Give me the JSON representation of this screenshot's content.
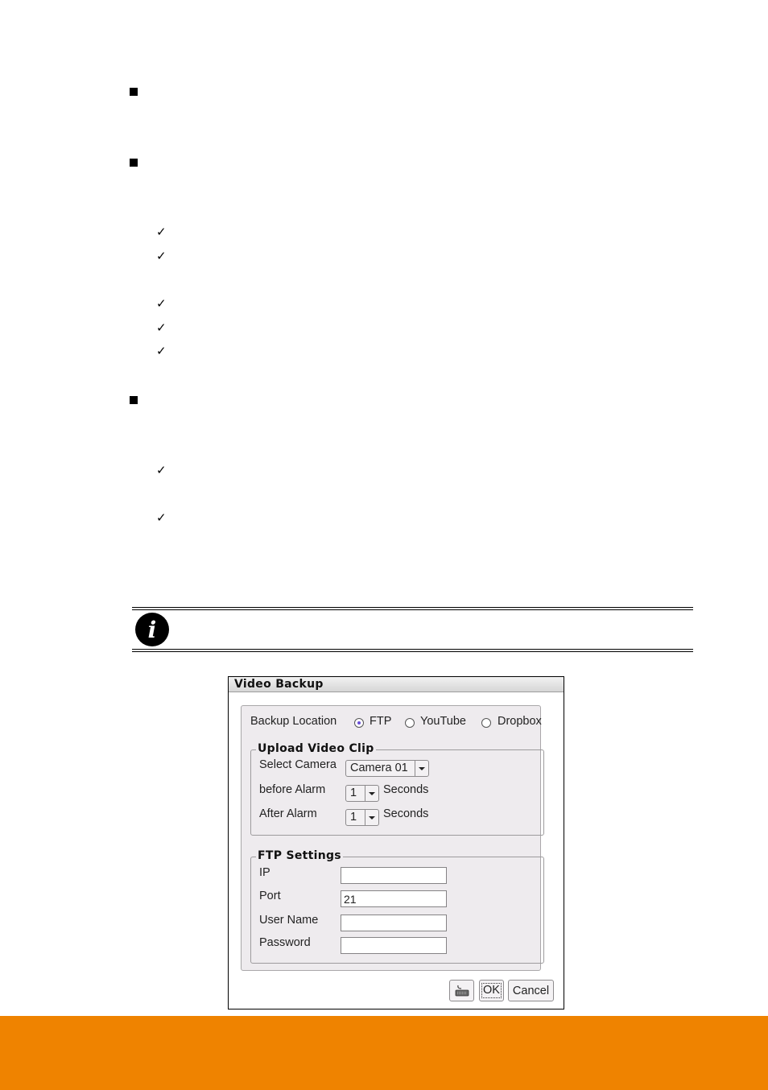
{
  "page": {
    "bullets": [
      {
        "text": ""
      },
      {
        "text": ""
      },
      {
        "text": ""
      }
    ],
    "checks": [
      {
        "text": ""
      },
      {
        "text": ""
      },
      {
        "text": ""
      },
      {
        "text": ""
      },
      {
        "text": ""
      },
      {
        "text": ""
      },
      {
        "text": ""
      }
    ],
    "check_glyph": "✓",
    "note": {
      "icon": "info-icon",
      "glyph": "i",
      "text": ""
    },
    "footer_color": "#ef8300"
  },
  "dialog": {
    "title": "Video Backup",
    "backup_location": {
      "label": "Backup Location",
      "options": [
        {
          "label": "FTP",
          "selected": true
        },
        {
          "label": "YouTube",
          "selected": false
        },
        {
          "label": "Dropbox",
          "selected": false
        }
      ]
    },
    "upload_video_clip": {
      "title": "Upload Video Clip",
      "select_camera": {
        "label": "Select Camera",
        "value": "Camera 01"
      },
      "before_alarm": {
        "label": "before Alarm",
        "value": "1",
        "unit": "Seconds"
      },
      "after_alarm": {
        "label": "After Alarm",
        "value": "1",
        "unit": "Seconds"
      }
    },
    "ftp_settings": {
      "title": "FTP Settings",
      "ip": {
        "label": "IP",
        "value": ""
      },
      "port": {
        "label": "Port",
        "value": "21"
      },
      "user_name": {
        "label": "User Name",
        "value": ""
      },
      "password": {
        "label": "Password",
        "value": ""
      }
    },
    "buttons": {
      "keyboard": "keyboard-icon",
      "ok": "OK",
      "cancel": "Cancel"
    }
  }
}
